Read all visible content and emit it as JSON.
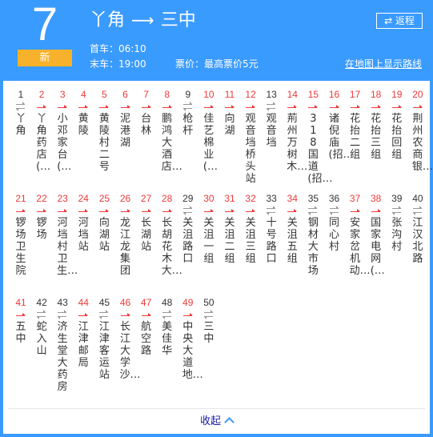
{
  "header": {
    "route_number": "7",
    "badge": "新",
    "origin": "丫角",
    "destination": "三中",
    "arrow": "⟶",
    "first_bus": "首车：06:10",
    "last_bus": "末车：19:00",
    "fare": "票价：最高票价5元",
    "return_button": "⇄ 返程",
    "map_link": "在地图上显示路线"
  },
  "colors": {
    "header_bg": "#3a9bff",
    "badge_bg": "#f7b12a",
    "one_way": "#ef3a3a",
    "two_way": "#999999"
  },
  "stops": [
    {
      "num": "1",
      "name": "丫角",
      "dir": "both"
    },
    {
      "num": "2",
      "name": "丫角药店(…",
      "dir": "one"
    },
    {
      "num": "3",
      "name": "小邓家台(…",
      "dir": "one"
    },
    {
      "num": "4",
      "name": "黄陵",
      "dir": "one"
    },
    {
      "num": "5",
      "name": "黄陵村二号",
      "dir": "one"
    },
    {
      "num": "6",
      "name": "泥港湖",
      "dir": "one"
    },
    {
      "num": "7",
      "name": "台林",
      "dir": "one"
    },
    {
      "num": "8",
      "name": "鹏鸿大酒店…",
      "dir": "one"
    },
    {
      "num": "9",
      "name": "枪杆",
      "dir": "both"
    },
    {
      "num": "10",
      "name": "佳艺棉业(…",
      "dir": "one"
    },
    {
      "num": "11",
      "name": "向湖",
      "dir": "one"
    },
    {
      "num": "12",
      "name": "观音垱桥头站",
      "dir": "one"
    },
    {
      "num": "13",
      "name": "观音垱",
      "dir": "both"
    },
    {
      "num": "14",
      "name": "荊州万树木…",
      "dir": "one"
    },
    {
      "num": "15",
      "name": "318国道(招…",
      "dir": "one"
    },
    {
      "num": "16",
      "name": "诸倪庙(招…",
      "dir": "one"
    },
    {
      "num": "17",
      "name": "花抬二组",
      "dir": "one"
    },
    {
      "num": "18",
      "name": "花抬三组",
      "dir": "one"
    },
    {
      "num": "19",
      "name": "花抬回组",
      "dir": "one"
    },
    {
      "num": "20",
      "name": "荆州农商银…",
      "dir": "one"
    },
    {
      "num": "21",
      "name": "锣场卫生院",
      "dir": "one"
    },
    {
      "num": "22",
      "name": "锣场",
      "dir": "one"
    },
    {
      "num": "23",
      "name": "河垱村卫生…",
      "dir": "one"
    },
    {
      "num": "24",
      "name": "河垱站",
      "dir": "one"
    },
    {
      "num": "25",
      "name": "向湖站",
      "dir": "one"
    },
    {
      "num": "26",
      "name": "龙江龙集团",
      "dir": "one"
    },
    {
      "num": "27",
      "name": "长湖站",
      "dir": "one"
    },
    {
      "num": "28",
      "name": "长胡花木大…",
      "dir": "one"
    },
    {
      "num": "29",
      "name": "关沮路口",
      "dir": "both"
    },
    {
      "num": "30",
      "name": "关沮一组",
      "dir": "one"
    },
    {
      "num": "31",
      "name": "关沮二组",
      "dir": "one"
    },
    {
      "num": "32",
      "name": "关沮三组",
      "dir": "one"
    },
    {
      "num": "33",
      "name": "十号路口",
      "dir": "both"
    },
    {
      "num": "34",
      "name": "关沮五组",
      "dir": "one"
    },
    {
      "num": "35",
      "name": "钢材大市场",
      "dir": "both"
    },
    {
      "num": "36",
      "name": "同心村",
      "dir": "both"
    },
    {
      "num": "37",
      "name": "安家岔机动…",
      "dir": "one"
    },
    {
      "num": "38",
      "name": "国家电网(…",
      "dir": "one"
    },
    {
      "num": "39",
      "name": "张沟村",
      "dir": "both"
    },
    {
      "num": "40",
      "name": "江汉北路",
      "dir": "both"
    },
    {
      "num": "41",
      "name": "五中",
      "dir": "one"
    },
    {
      "num": "42",
      "name": "蛇入山",
      "dir": "both"
    },
    {
      "num": "43",
      "name": "济生堂大药房",
      "dir": "both"
    },
    {
      "num": "44",
      "name": "江津邮局",
      "dir": "one"
    },
    {
      "num": "45",
      "name": "江津客运站",
      "dir": "both"
    },
    {
      "num": "46",
      "name": "长江大学沙…",
      "dir": "one"
    },
    {
      "num": "47",
      "name": "航空路",
      "dir": "one"
    },
    {
      "num": "48",
      "name": "美佳华",
      "dir": "both"
    },
    {
      "num": "49",
      "name": "中央大道地…",
      "dir": "one"
    },
    {
      "num": "50",
      "name": "三中",
      "dir": "both"
    }
  ],
  "footer": {
    "collapse_label": "收起"
  }
}
